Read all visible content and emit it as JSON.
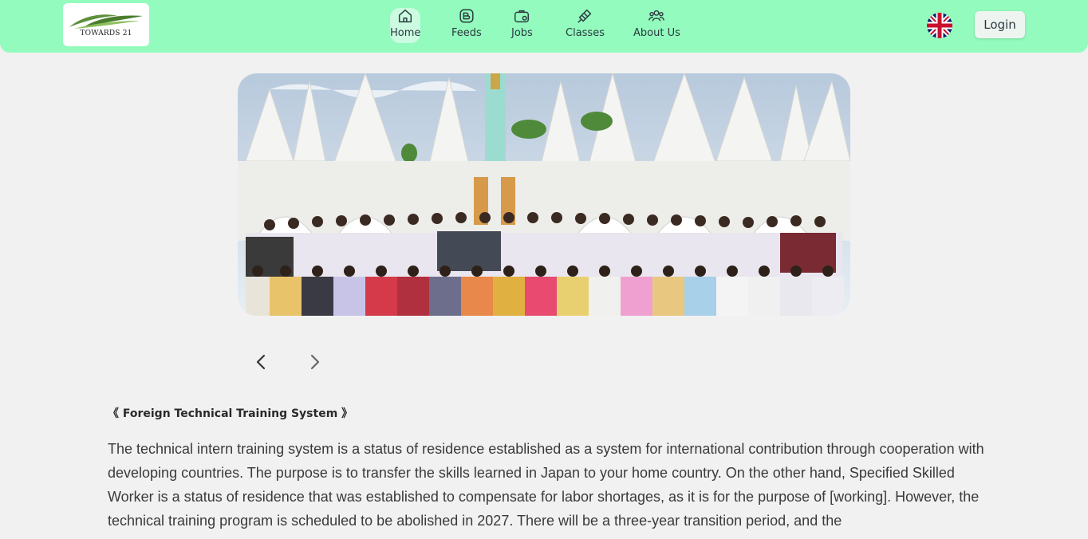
{
  "header": {
    "logo_text": "TOWARDS 21",
    "nav": [
      {
        "label": "Home",
        "icon": "home-icon"
      },
      {
        "label": "Feeds",
        "icon": "feeds-icon"
      },
      {
        "label": "Jobs",
        "icon": "jobs-icon"
      },
      {
        "label": "Classes",
        "icon": "classes-icon"
      },
      {
        "label": "About Us",
        "icon": "about-us-icon"
      }
    ],
    "active_nav": "Home",
    "language_flag": "uk-flag-icon",
    "login_label": "Login"
  },
  "carousel": {
    "prev_icon": "chevron-left-icon",
    "next_icon": "chevron-right-icon"
  },
  "content": {
    "heading": "《 Foreign Technical Training System 》",
    "body": "The technical intern training system is a status of residence established as a system for international contribution through cooperation with developing countries. The purpose is to transfer the skills learned in Japan to your home country. On the other hand, Specified Skilled Worker is a status of residence that was established to compensate for labor shortages, as it is for the purpose of [working]. However, the technical training program is scheduled to be abolished in 2027. There will be a three-year transition period, and the"
  },
  "colors": {
    "header_bg": "#93fbbd",
    "page_bg": "#f1f1f1",
    "text": "#3a3a3a"
  }
}
